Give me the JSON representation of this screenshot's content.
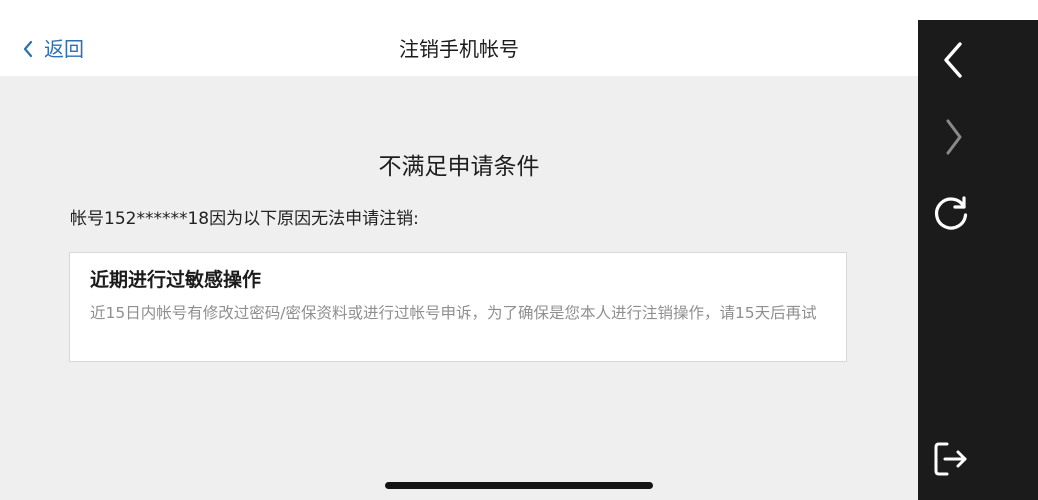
{
  "navbar": {
    "back_label": "返回",
    "title": "注销手机帐号"
  },
  "content": {
    "heading": "不满足申请条件",
    "intro": "帐号152******18因为以下原因无法申请注销:",
    "reason": {
      "title": "近期进行过敏感操作",
      "description": "近15日内帐号有修改过密码/密保资料或进行过帐号申诉，为了确保是您本人进行注销操作，请15天后再试"
    }
  },
  "toolbar": {
    "buttons": [
      {
        "icon": "chevron-left-icon",
        "enabled": true
      },
      {
        "icon": "chevron-right-icon",
        "enabled": false
      },
      {
        "icon": "refresh-icon",
        "enabled": true
      },
      {
        "icon": "exit-icon",
        "enabled": true
      }
    ]
  },
  "colors": {
    "accent": "#2f6fb2",
    "page_background": "#efefef",
    "toolbar_background": "#1b1b1b",
    "toolbar_icon": "#ffffff",
    "toolbar_icon_disabled": "#8a8a8a"
  }
}
